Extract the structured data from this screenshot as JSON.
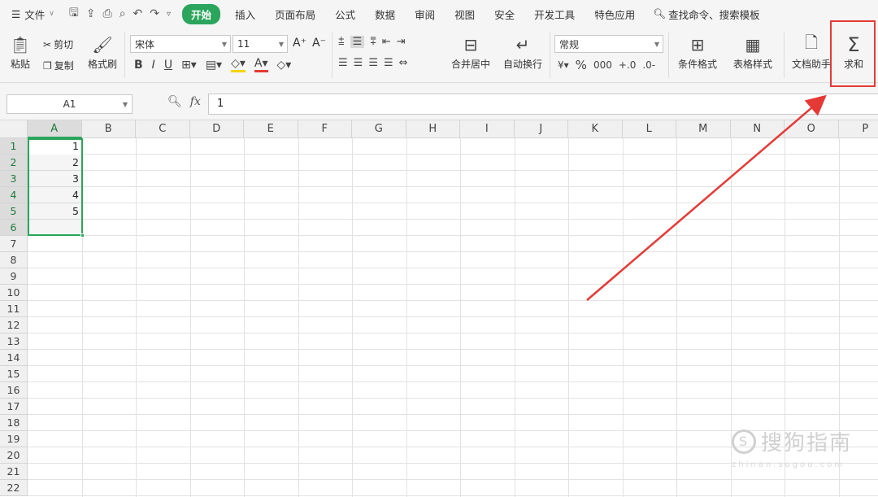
{
  "menubar": {
    "file_label": "文件",
    "tabs": [
      "开始",
      "插入",
      "页面布局",
      "公式",
      "数据",
      "审阅",
      "视图",
      "安全",
      "开发工具",
      "特色应用"
    ],
    "search_label": "查找命令、搜索模板"
  },
  "ribbon": {
    "paste": "粘贴",
    "cut": "剪切",
    "copy": "复制",
    "format_painter": "格式刷",
    "font_name": "宋体",
    "font_size": "11",
    "merge_center": "合并居中",
    "wrap_text": "自动换行",
    "number_format": "常规",
    "conditional_format": "条件格式",
    "table_style": "表格样式",
    "doc_assistant": "文档助手",
    "sum": "求和"
  },
  "formula_bar": {
    "name_box": "A1",
    "fx_label": "fx",
    "value": "1"
  },
  "sheet": {
    "columns": [
      "A",
      "B",
      "C",
      "D",
      "E",
      "F",
      "G",
      "H",
      "I",
      "J",
      "K",
      "L",
      "M",
      "N",
      "O",
      "P"
    ],
    "rows": [
      "1",
      "2",
      "3",
      "4",
      "5",
      "6",
      "7",
      "8",
      "9",
      "10",
      "11",
      "12",
      "13",
      "14",
      "15",
      "16",
      "17",
      "18",
      "19",
      "20",
      "21",
      "22"
    ],
    "cells_A": [
      "1",
      "2",
      "3",
      "4",
      "5"
    ]
  },
  "watermark": {
    "text": "搜狗指南",
    "sub": "zhinan.sogou.com"
  },
  "colors": {
    "accent": "#2aa55b",
    "annotation": "#e53935"
  }
}
